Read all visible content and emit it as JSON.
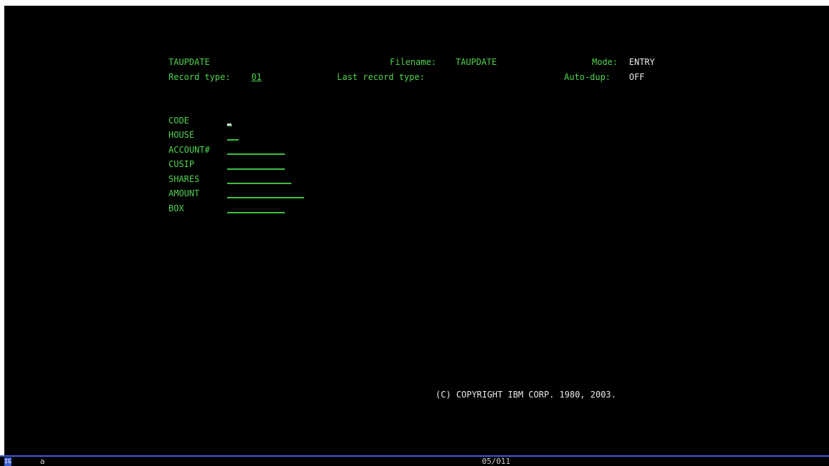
{
  "header": {
    "program_name": "TAUPDATE",
    "filename_label": "Filename:",
    "filename_value": "TAUPDATE",
    "mode_label": "Mode:",
    "mode_value": "ENTRY",
    "record_type_label": "Record type:",
    "record_type_value": "01",
    "last_record_type_label": "Last record type:",
    "autodup_label": "Auto-dup:",
    "autodup_value": "OFF"
  },
  "fields": [
    {
      "label": "CODE",
      "value": ""
    },
    {
      "label": "HOUSE",
      "value": ""
    },
    {
      "label": "ACCOUNT#",
      "value": ""
    },
    {
      "label": "CUSIP",
      "value": ""
    },
    {
      "label": "SHARES",
      "value": ""
    },
    {
      "label": "AMOUNT",
      "value": ""
    },
    {
      "label": "BOX",
      "value": ""
    }
  ],
  "copyright": "(C) COPYRIGHT IBM CORP. 1980, 2003.",
  "statusbar": {
    "indicator": "IG",
    "left_char": "a",
    "cursor_position": "05/011"
  },
  "colors": {
    "background": "#000000",
    "text_green": "#4fd24f",
    "text_white": "#e9e9e9",
    "statusbar_accent": "#3d5fd0"
  }
}
